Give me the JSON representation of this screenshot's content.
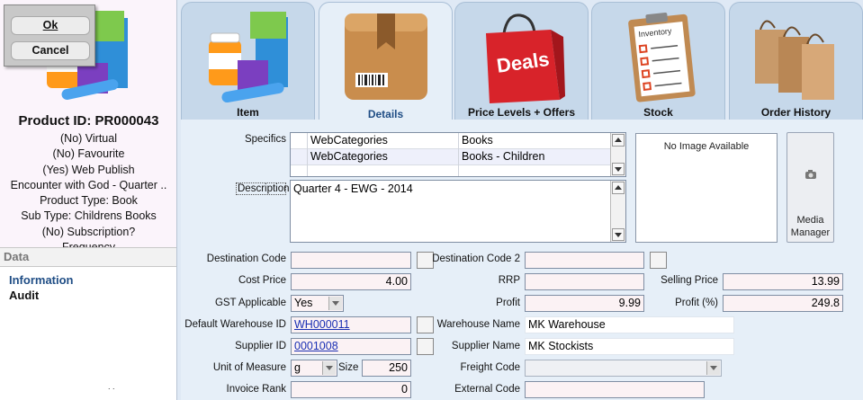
{
  "dialog": {
    "ok_label": "Ok",
    "cancel_label": "Cancel"
  },
  "product": {
    "title": "Product ID: PR000043",
    "lines": [
      "(No) Virtual",
      "(No) Favourite",
      "(Yes) Web Publish",
      "Encounter with God - Quarter ..",
      "Product Type: Book",
      "Sub Type: Childrens Books",
      "(No) Subscription?",
      "Frequency"
    ]
  },
  "data_panel": {
    "header": "Data",
    "items": [
      {
        "label": "Information",
        "active": true
      },
      {
        "label": "Audit",
        "active": false
      }
    ],
    "tiny_text": ". ."
  },
  "tabs": [
    {
      "label": "Item",
      "icon": "products-icon",
      "active": false
    },
    {
      "label": "Details",
      "icon": "box-icon",
      "active": true
    },
    {
      "label": "Price Levels + Offers",
      "icon": "deals-bag-icon",
      "active": false
    },
    {
      "label": "Stock",
      "icon": "inventory-clipboard-icon",
      "active": false
    },
    {
      "label": "Order History",
      "icon": "shopping-bags-icon",
      "active": false
    }
  ],
  "deals_text": "Deals",
  "inventory_text": "Inventory",
  "form": {
    "specifics_label": "Specifics",
    "specifics_rows": [
      {
        "key": "WebCategories",
        "value": "Books"
      },
      {
        "key": "WebCategories",
        "value": "Books - Children"
      },
      {
        "key": "",
        "value": ""
      }
    ],
    "description_label": "Description",
    "description_value": "Quarter 4 - EWG - 2014",
    "image_placeholder": "No Image Available",
    "media_button": "Media Manager",
    "destination_code_label": "Destination Code",
    "destination_code_value": "",
    "destination_code2_label": "Destination Code 2",
    "destination_code2_value": "",
    "cost_price_label": "Cost Price",
    "cost_price_value": "4.00",
    "rrp_label": "RRP",
    "rrp_value": "",
    "selling_price_label": "Selling Price",
    "selling_price_value": "13.99",
    "gst_label": "GST Applicable",
    "gst_value": "Yes",
    "profit_label": "Profit",
    "profit_value": "9.99",
    "profit_pct_label": "Profit (%)",
    "profit_pct_value": "249.8",
    "warehouse_id_label": "Default Warehouse ID",
    "warehouse_id_value": "WH000011",
    "warehouse_name_label": "Warehouse Name",
    "warehouse_name_value": "MK Warehouse",
    "supplier_id_label": "Supplier ID",
    "supplier_id_value": "0001008",
    "supplier_name_label": "Supplier Name",
    "supplier_name_value": "MK Stockists",
    "uom_label": "Unit of Measure",
    "uom_value": "g",
    "size_label": "Size",
    "size_value": "250",
    "freight_code_label": "Freight Code",
    "freight_code_value": "",
    "invoice_rank_label": "Invoice Rank",
    "invoice_rank_value": "0",
    "external_code_label": "External Code",
    "external_code_value": ""
  }
}
